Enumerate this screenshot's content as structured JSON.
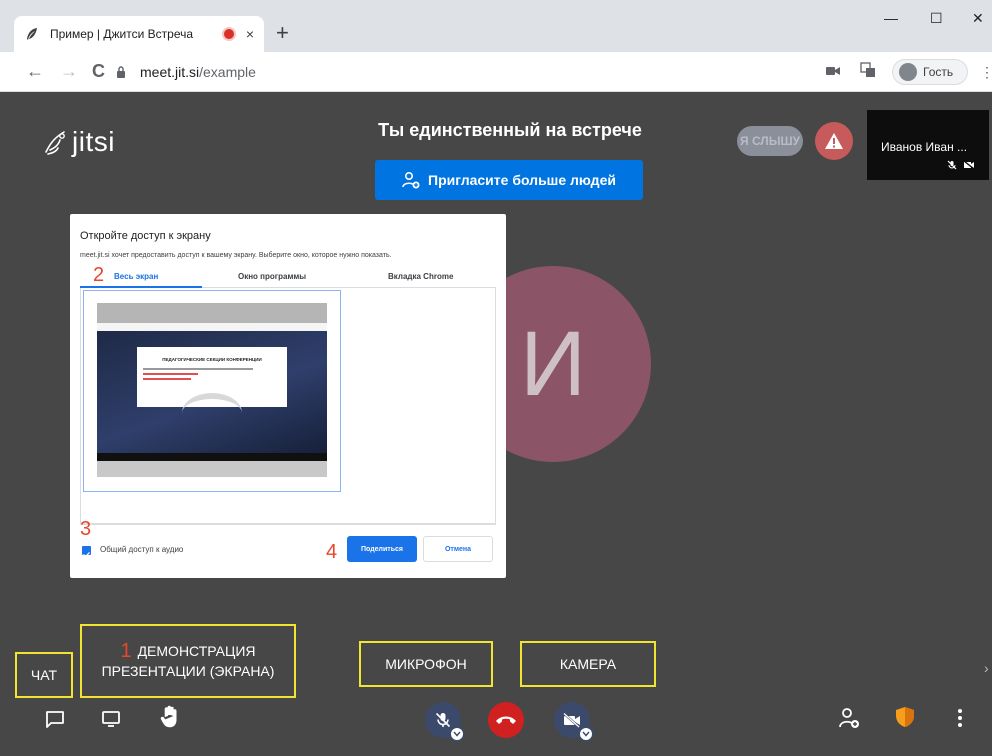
{
  "browser": {
    "tab_title": "Пример | Джитси Встреча",
    "tab_close": "×",
    "new_tab": "+",
    "url_host": "meet.jit.si",
    "url_path": "/example",
    "guest_label": "Гость",
    "window_min": "—",
    "window_max": "☐",
    "window_close": "✕",
    "nav_back": "←",
    "nav_forward": "→",
    "nav_reload": "C",
    "menu": "⋮"
  },
  "meeting": {
    "logo_text": "jitsi",
    "title": "Ты единственный на встрече",
    "invite_label": "Пригласите больше людей",
    "hear_pill": "Я СЛЫШУ",
    "participant_name": "Иванов Иван ...",
    "big_avatar_letter": "И"
  },
  "dialog": {
    "title": "Откройте доступ к экрану",
    "description": "meet.jit.si хочет предоставить доступ к вашему экрану. Выберите окно, которое нужно показать.",
    "tabs": [
      "Весь экран",
      "Окно программы",
      "Вкладка Chrome"
    ],
    "preview_title": "ПЕДАГОГИЧЕСКИЕ СЕКЦИИ КОНФЕРЕНЦИИ",
    "audio_label": "Общий доступ к аудио",
    "share_label": "Поделиться",
    "cancel_label": "Отмена"
  },
  "steps": [
    "1",
    "2",
    "3",
    "4"
  ],
  "callouts": {
    "chat": "ЧАТ",
    "screen_share_line1": "ДЕМОНСТРАЦИЯ",
    "screen_share_line2": "ПРЕЗЕНТАЦИИ (ЭКРАНА)",
    "mic": "МИКРОФОН",
    "camera": "КАМЕРА"
  },
  "icons": {
    "favicon": "feather-icon",
    "chat": "chat-icon",
    "screen": "screen-share-icon",
    "hand": "raise-hand-icon",
    "mic": "mic-muted-icon",
    "hangup": "hangup-icon",
    "camera": "camera-off-icon",
    "invite": "add-person-icon",
    "security": "shield-icon",
    "more": "more-vertical-icon"
  },
  "colors": {
    "meeting_bg": "#474747",
    "invite_blue": "#0074e0",
    "callout_yellow": "#f1e531",
    "step_red": "#e8472a",
    "hangup_red": "#d12020",
    "avatar_purple": "#8b5567"
  }
}
